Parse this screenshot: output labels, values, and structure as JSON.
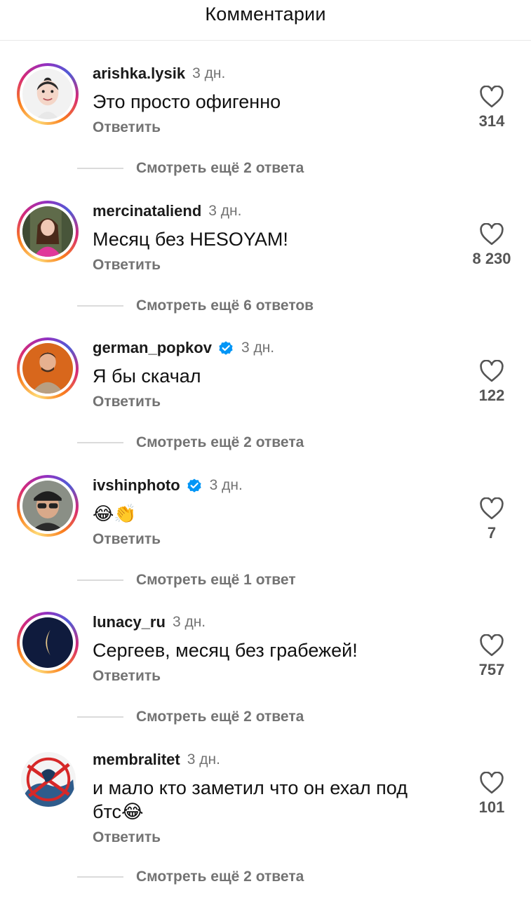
{
  "header": {
    "title": "Комментарии"
  },
  "comments": [
    {
      "username": "arishka.lysik",
      "verified": false,
      "time": "3 дн.",
      "text": "Это просто офигенно",
      "reply": "Ответить",
      "likes": "314",
      "more": "Смотреть ещё 2 ответа"
    },
    {
      "username": "mercinataliend",
      "verified": false,
      "time": "3 дн.",
      "text": "Месяц без HESOYAM!",
      "reply": "Ответить",
      "likes": "8 230",
      "more": "Смотреть ещё 6 ответов"
    },
    {
      "username": "german_popkov",
      "verified": true,
      "time": "3 дн.",
      "text": "Я бы скачал",
      "reply": "Ответить",
      "likes": "122",
      "more": "Смотреть ещё 2 ответа"
    },
    {
      "username": "ivshinphoto",
      "verified": true,
      "time": "3 дн.",
      "text": "😂👏",
      "reply": "Ответить",
      "likes": "7",
      "more": "Смотреть ещё 1 ответ"
    },
    {
      "username": "lunacy_ru",
      "verified": false,
      "time": "3 дн.",
      "text": "Сергеев, месяц без грабежей!",
      "reply": "Ответить",
      "likes": "757",
      "more": "Смотреть ещё 2 ответа"
    },
    {
      "username": "membralitet",
      "verified": false,
      "time": "3 дн.",
      "text": "и мало кто заметил что он ехал под",
      "text2": "бтс😂",
      "reply": "Ответить",
      "likes": "101",
      "more": "Смотреть ещё 2 ответа"
    }
  ],
  "colors": {
    "verified": "#0095f6",
    "muted": "#737373"
  }
}
